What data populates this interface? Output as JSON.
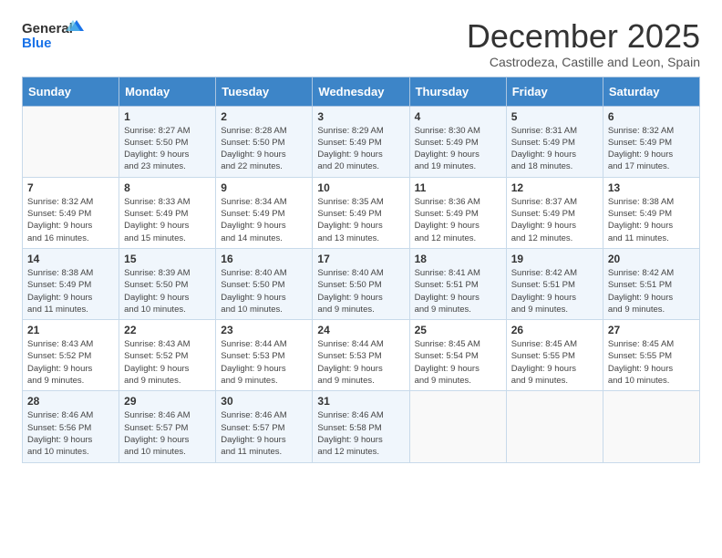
{
  "logo": {
    "line1": "General",
    "line2": "Blue"
  },
  "title": "December 2025",
  "subtitle": "Castrodeza, Castille and Leon, Spain",
  "days_of_week": [
    "Sunday",
    "Monday",
    "Tuesday",
    "Wednesday",
    "Thursday",
    "Friday",
    "Saturday"
  ],
  "weeks": [
    [
      {
        "day": "",
        "info": ""
      },
      {
        "day": "1",
        "info": "Sunrise: 8:27 AM\nSunset: 5:50 PM\nDaylight: 9 hours\nand 23 minutes."
      },
      {
        "day": "2",
        "info": "Sunrise: 8:28 AM\nSunset: 5:50 PM\nDaylight: 9 hours\nand 22 minutes."
      },
      {
        "day": "3",
        "info": "Sunrise: 8:29 AM\nSunset: 5:49 PM\nDaylight: 9 hours\nand 20 minutes."
      },
      {
        "day": "4",
        "info": "Sunrise: 8:30 AM\nSunset: 5:49 PM\nDaylight: 9 hours\nand 19 minutes."
      },
      {
        "day": "5",
        "info": "Sunrise: 8:31 AM\nSunset: 5:49 PM\nDaylight: 9 hours\nand 18 minutes."
      },
      {
        "day": "6",
        "info": "Sunrise: 8:32 AM\nSunset: 5:49 PM\nDaylight: 9 hours\nand 17 minutes."
      }
    ],
    [
      {
        "day": "7",
        "info": "Sunrise: 8:32 AM\nSunset: 5:49 PM\nDaylight: 9 hours\nand 16 minutes."
      },
      {
        "day": "8",
        "info": "Sunrise: 8:33 AM\nSunset: 5:49 PM\nDaylight: 9 hours\nand 15 minutes."
      },
      {
        "day": "9",
        "info": "Sunrise: 8:34 AM\nSunset: 5:49 PM\nDaylight: 9 hours\nand 14 minutes."
      },
      {
        "day": "10",
        "info": "Sunrise: 8:35 AM\nSunset: 5:49 PM\nDaylight: 9 hours\nand 13 minutes."
      },
      {
        "day": "11",
        "info": "Sunrise: 8:36 AM\nSunset: 5:49 PM\nDaylight: 9 hours\nand 12 minutes."
      },
      {
        "day": "12",
        "info": "Sunrise: 8:37 AM\nSunset: 5:49 PM\nDaylight: 9 hours\nand 12 minutes."
      },
      {
        "day": "13",
        "info": "Sunrise: 8:38 AM\nSunset: 5:49 PM\nDaylight: 9 hours\nand 11 minutes."
      }
    ],
    [
      {
        "day": "14",
        "info": "Sunrise: 8:38 AM\nSunset: 5:49 PM\nDaylight: 9 hours\nand 11 minutes."
      },
      {
        "day": "15",
        "info": "Sunrise: 8:39 AM\nSunset: 5:50 PM\nDaylight: 9 hours\nand 10 minutes."
      },
      {
        "day": "16",
        "info": "Sunrise: 8:40 AM\nSunset: 5:50 PM\nDaylight: 9 hours\nand 10 minutes."
      },
      {
        "day": "17",
        "info": "Sunrise: 8:40 AM\nSunset: 5:50 PM\nDaylight: 9 hours\nand 9 minutes."
      },
      {
        "day": "18",
        "info": "Sunrise: 8:41 AM\nSunset: 5:51 PM\nDaylight: 9 hours\nand 9 minutes."
      },
      {
        "day": "19",
        "info": "Sunrise: 8:42 AM\nSunset: 5:51 PM\nDaylight: 9 hours\nand 9 minutes."
      },
      {
        "day": "20",
        "info": "Sunrise: 8:42 AM\nSunset: 5:51 PM\nDaylight: 9 hours\nand 9 minutes."
      }
    ],
    [
      {
        "day": "21",
        "info": "Sunrise: 8:43 AM\nSunset: 5:52 PM\nDaylight: 9 hours\nand 9 minutes."
      },
      {
        "day": "22",
        "info": "Sunrise: 8:43 AM\nSunset: 5:52 PM\nDaylight: 9 hours\nand 9 minutes."
      },
      {
        "day": "23",
        "info": "Sunrise: 8:44 AM\nSunset: 5:53 PM\nDaylight: 9 hours\nand 9 minutes."
      },
      {
        "day": "24",
        "info": "Sunrise: 8:44 AM\nSunset: 5:53 PM\nDaylight: 9 hours\nand 9 minutes."
      },
      {
        "day": "25",
        "info": "Sunrise: 8:45 AM\nSunset: 5:54 PM\nDaylight: 9 hours\nand 9 minutes."
      },
      {
        "day": "26",
        "info": "Sunrise: 8:45 AM\nSunset: 5:55 PM\nDaylight: 9 hours\nand 9 minutes."
      },
      {
        "day": "27",
        "info": "Sunrise: 8:45 AM\nSunset: 5:55 PM\nDaylight: 9 hours\nand 10 minutes."
      }
    ],
    [
      {
        "day": "28",
        "info": "Sunrise: 8:46 AM\nSunset: 5:56 PM\nDaylight: 9 hours\nand 10 minutes."
      },
      {
        "day": "29",
        "info": "Sunrise: 8:46 AM\nSunset: 5:57 PM\nDaylight: 9 hours\nand 10 minutes."
      },
      {
        "day": "30",
        "info": "Sunrise: 8:46 AM\nSunset: 5:57 PM\nDaylight: 9 hours\nand 11 minutes."
      },
      {
        "day": "31",
        "info": "Sunrise: 8:46 AM\nSunset: 5:58 PM\nDaylight: 9 hours\nand 12 minutes."
      },
      {
        "day": "",
        "info": ""
      },
      {
        "day": "",
        "info": ""
      },
      {
        "day": "",
        "info": ""
      }
    ]
  ]
}
